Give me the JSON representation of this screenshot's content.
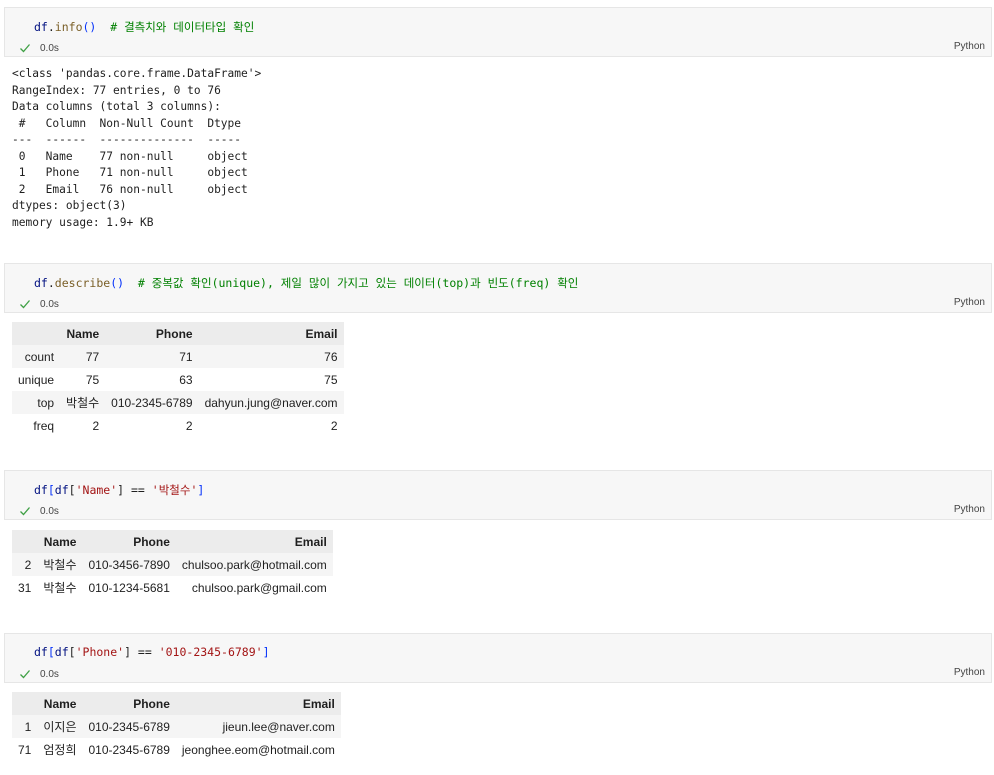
{
  "cells": [
    {
      "code": {
        "obj": "df",
        "dot": ".",
        "method": "info",
        "args": "()",
        "comment": "# 결측치와 데이터타입 확인"
      },
      "status": "0.0s",
      "language": "Python",
      "output_lines": [
        "<class 'pandas.core.frame.DataFrame'>",
        "RangeIndex: 77 entries, 0 to 76",
        "Data columns (total 3 columns):",
        " #   Column  Non-Null Count  Dtype ",
        "---  ------  --------------  ----- ",
        " 0   Name    77 non-null     object",
        " 1   Phone   71 non-null     object",
        " 2   Email   76 non-null     object",
        "dtypes: object(3)",
        "memory usage: 1.9+ KB"
      ]
    },
    {
      "code": {
        "obj": "df",
        "dot": ".",
        "method": "describe",
        "args": "()",
        "comment": "# 중복값 확인(unique), 제일 많이 가지고 있는 데이터(top)과 빈도(freq) 확인"
      },
      "status": "0.0s",
      "language": "Python",
      "table": {
        "columns": [
          "",
          "Name",
          "Phone",
          "Email"
        ],
        "rows": [
          [
            "count",
            "77",
            "71",
            "76"
          ],
          [
            "unique",
            "75",
            "63",
            "75"
          ],
          [
            "top",
            "박철수",
            "010-2345-6789",
            "dahyun.jung@naver.com"
          ],
          [
            "freq",
            "2",
            "2",
            "2"
          ]
        ]
      }
    },
    {
      "code": {
        "df1": "df",
        "open1": "[",
        "df2": "df",
        "open2": "[",
        "key": "'Name'",
        "close2": "]",
        "op": " == ",
        "value": "'박철수'",
        "close1": "]"
      },
      "status": "0.0s",
      "language": "Python",
      "table": {
        "columns": [
          "",
          "Name",
          "Phone",
          "Email"
        ],
        "rows": [
          [
            "2",
            "박철수",
            "010-3456-7890",
            "chulsoo.park@hotmail.com"
          ],
          [
            "31",
            "박철수",
            "010-1234-5681",
            "chulsoo.park@gmail.com"
          ]
        ]
      }
    },
    {
      "code": {
        "df1": "df",
        "open1": "[",
        "df2": "df",
        "open2": "[",
        "key": "'Phone'",
        "close2": "]",
        "op": " == ",
        "value": "'010-2345-6789'",
        "close1": "]"
      },
      "status": "0.0s",
      "language": "Python",
      "table": {
        "columns": [
          "",
          "Name",
          "Phone",
          "Email"
        ],
        "rows": [
          [
            "1",
            "이지은",
            "010-2345-6789",
            "jieun.lee@naver.com"
          ],
          [
            "71",
            "엄정희",
            "010-2345-6789",
            "jeonghee.eom@hotmail.com"
          ]
        ]
      }
    }
  ],
  "colors": {
    "check": "#3fa045",
    "comment": "#008000",
    "string": "#a31515",
    "function": "#795e26",
    "variable": "#001080"
  },
  "icons": {
    "status": "check-icon"
  }
}
